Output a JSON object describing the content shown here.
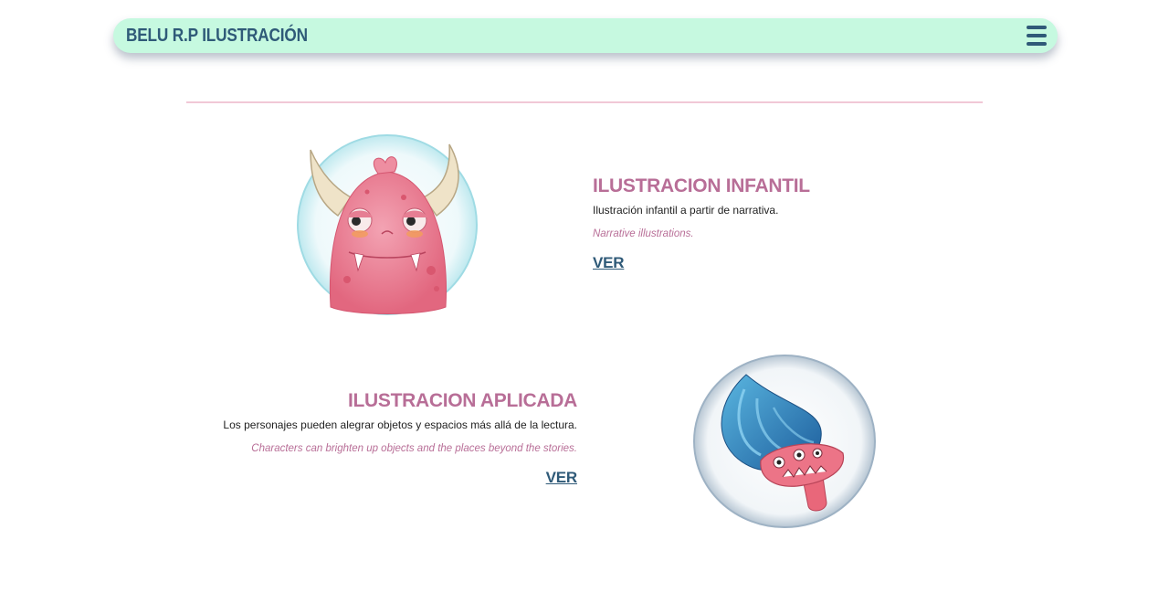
{
  "header": {
    "brand": "BELU R.P ILUSTRACIÓN",
    "menu_icon": "hamburger-menu-icon"
  },
  "sections": [
    {
      "title": "ILUSTRACION INFANTIL",
      "description": "Ilustración infantil a partir de narrativa.",
      "english": "Narrative illustrations.",
      "link": "VER",
      "image": "pink-horned-monster-illustration"
    },
    {
      "title": "ILUSTRACION APLICADA",
      "description": "Los personajes pueden alegrar objetos y espacios más allá de la lectura.",
      "english": "Characters can brighten up objects and the places beyond the stories.",
      "link": "VER",
      "image": "blue-mushroom-monster-illustration"
    }
  ],
  "colors": {
    "nav_background": "#c6f9e0",
    "brand_text": "#2f5a78",
    "title_pink": "#b86e97",
    "divider_pink": "#f1c8d6"
  }
}
